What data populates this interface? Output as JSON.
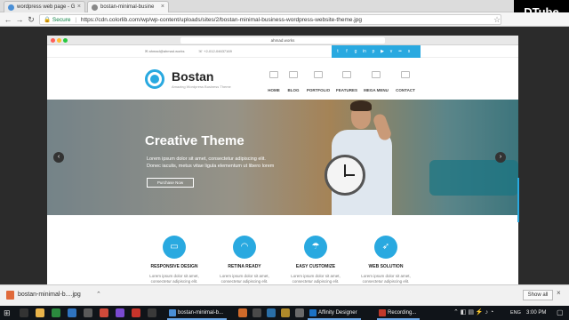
{
  "browser": {
    "tabs": [
      {
        "label": "wordpress web page - G",
        "active": false
      },
      {
        "label": "bostan-minimal-busine",
        "active": true
      }
    ],
    "secure_label": "Secure",
    "url": "https://cdn.colorlib.com/wp/wp-content/uploads/sites/2/bostan-minimal-business-wordpress-website-theme.jpg",
    "overlay_logo": "DTube"
  },
  "mock_window": {
    "url": "ahmad.works",
    "topbar": {
      "email": "ahmad@ahmad.works",
      "phone": "+2-012-04637169"
    },
    "social_icons": [
      "twitter-icon",
      "facebook-icon",
      "google-plus-icon",
      "linkedin-icon",
      "pinterest-icon",
      "youtube-icon",
      "vimeo-icon",
      "flickr-icon",
      "skype-icon",
      "rss-icon"
    ],
    "social_glyphs": [
      "t",
      "f",
      "g",
      "in",
      "p",
      "▶",
      "v",
      "••",
      "s",
      "◉"
    ],
    "brand": "Bostan",
    "tagline": "Amazing Wordpress Business Theme",
    "nav": [
      "HOME",
      "BLOG",
      "PORTFOLIO",
      "FEATURES",
      "MEGA MENU",
      "CONTACT"
    ],
    "hero": {
      "title": "Creative Theme",
      "line1": "Lorem ipsum dolor sit amet, consectetur adipiscing elit.",
      "line2": "Donec iaculis, metus vitae ligula elementum ut libero lorem",
      "button": "Purchase Now"
    },
    "features": [
      {
        "title": "RESPONSIVE DESIGN",
        "icon": "monitor-icon",
        "glyph": "▭",
        "text": [
          "Lorem ipsum dolor sit amet,",
          "consectetur adipiscing elit."
        ]
      },
      {
        "title": "RETINA READY",
        "icon": "wifi-icon",
        "glyph": "◠",
        "text": [
          "Lorem ipsum dolor sit amet,",
          "consectetur adipiscing elit."
        ]
      },
      {
        "title": "EASY CUSTOMIZE",
        "icon": "umbrella-icon",
        "glyph": "☂",
        "text": [
          "Lorem ipsum dolor sit amet,",
          "consectetur adipiscing elit."
        ]
      },
      {
        "title": "WEB SOLUTION",
        "icon": "rocket-icon",
        "glyph": "➶",
        "text": [
          "Lorem ipsum dolor sit amet,",
          "consectetur adipiscing elit."
        ]
      }
    ]
  },
  "downloads": {
    "file": "bostan-minimal-b....jpg",
    "show_all": "Show all"
  },
  "taskbar": {
    "apps": [
      {
        "label": "bostan-minimal-b...",
        "color": "#4a8fd6"
      },
      {
        "label": "Affinity Designer",
        "color": "#1b72c5"
      },
      {
        "label": "Recording...",
        "color": "#c0392b"
      }
    ],
    "lang": "ENG",
    "time": "3:00 PM"
  },
  "colors": {
    "accent": "#29a9e0"
  }
}
